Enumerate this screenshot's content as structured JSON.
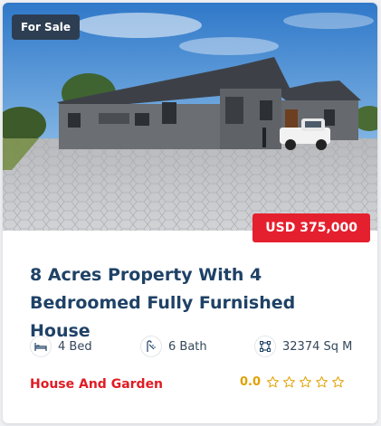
{
  "listing": {
    "status_badge": "For Sale",
    "price": "USD 375,000",
    "title": "8 Acres Property With 4 Bedroomed Fully Furnished House",
    "photo_icon": "house-photo",
    "features": [
      {
        "icon": "bed-icon",
        "label": "4 Bed"
      },
      {
        "icon": "bath-icon",
        "label": "6 Bath"
      },
      {
        "icon": "area-icon",
        "label": "32374 Sq M"
      }
    ],
    "category": "House And Garden",
    "rating": {
      "score": "0.0",
      "stars_filled": 0,
      "stars_total": 5
    }
  },
  "colors": {
    "title": "#1f4266",
    "price_badge": "#e5202e",
    "status_badge": "#2e3e52",
    "category": "#e01b24",
    "rating": "#e0a100"
  }
}
